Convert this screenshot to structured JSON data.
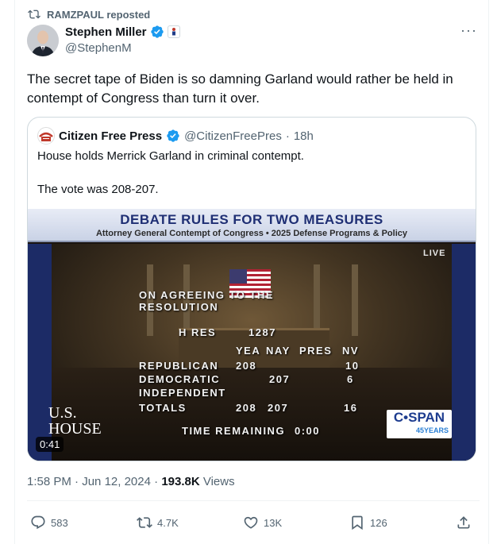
{
  "repost": {
    "label": "RAMZPAUL reposted"
  },
  "author": {
    "name": "Stephen Miller",
    "handle": "@StephenM"
  },
  "tweet": {
    "text": "The secret tape of Biden is so damning Garland would rather be held in contempt of Congress than turn it over."
  },
  "quote": {
    "name": "Citizen Free Press",
    "handle": "@CitizenFreePres",
    "separator": "·",
    "time": "18h",
    "line1": "House holds Merrick Garland in criminal contempt.",
    "line2": "The vote was 208-207."
  },
  "video": {
    "banner_title": "DEBATE RULES FOR TWO MEASURES",
    "banner_subtitle": "Attorney General Contempt of Congress • 2025 Defense Programs & Policy",
    "live": "LIVE",
    "vote_title_1": "ON AGREEING TO THE",
    "vote_title_2": "RESOLUTION",
    "h_res": "H RES",
    "h_res_num": "1287",
    "columns": [
      "YEA",
      "NAY",
      "PRES",
      "NV"
    ],
    "rows": [
      {
        "label": "REPUBLICAN",
        "yea": "208",
        "nay": "",
        "nv": "10"
      },
      {
        "label": "DEMOCRATIC",
        "yea": "",
        "nay": "207",
        "nv": "6"
      },
      {
        "label": "INDEPENDENT",
        "yea": "",
        "nay": "",
        "nv": ""
      },
      {
        "label": "TOTALS",
        "yea": "208",
        "nay": "207",
        "nv": "16"
      }
    ],
    "time_remaining_label": "TIME REMAINING",
    "time_remaining": "0:00",
    "us_house_1": "U.S.",
    "us_house_2": "HOUSE",
    "cspan": "C•SPAN",
    "cspan_sub": "45YEARS",
    "duration": "0:41"
  },
  "meta": {
    "time": "1:58 PM",
    "sep1": "·",
    "date": "Jun 12, 2024",
    "sep2": "·",
    "views_count": "193.8K",
    "views_label": "Views"
  },
  "actions": {
    "replies": "583",
    "reposts": "4.7K",
    "likes": "13K",
    "bookmarks": "126"
  },
  "colors": {
    "verified": "#1d9bf0",
    "secondary_text": "#536471",
    "primary_text": "#0f1419"
  }
}
